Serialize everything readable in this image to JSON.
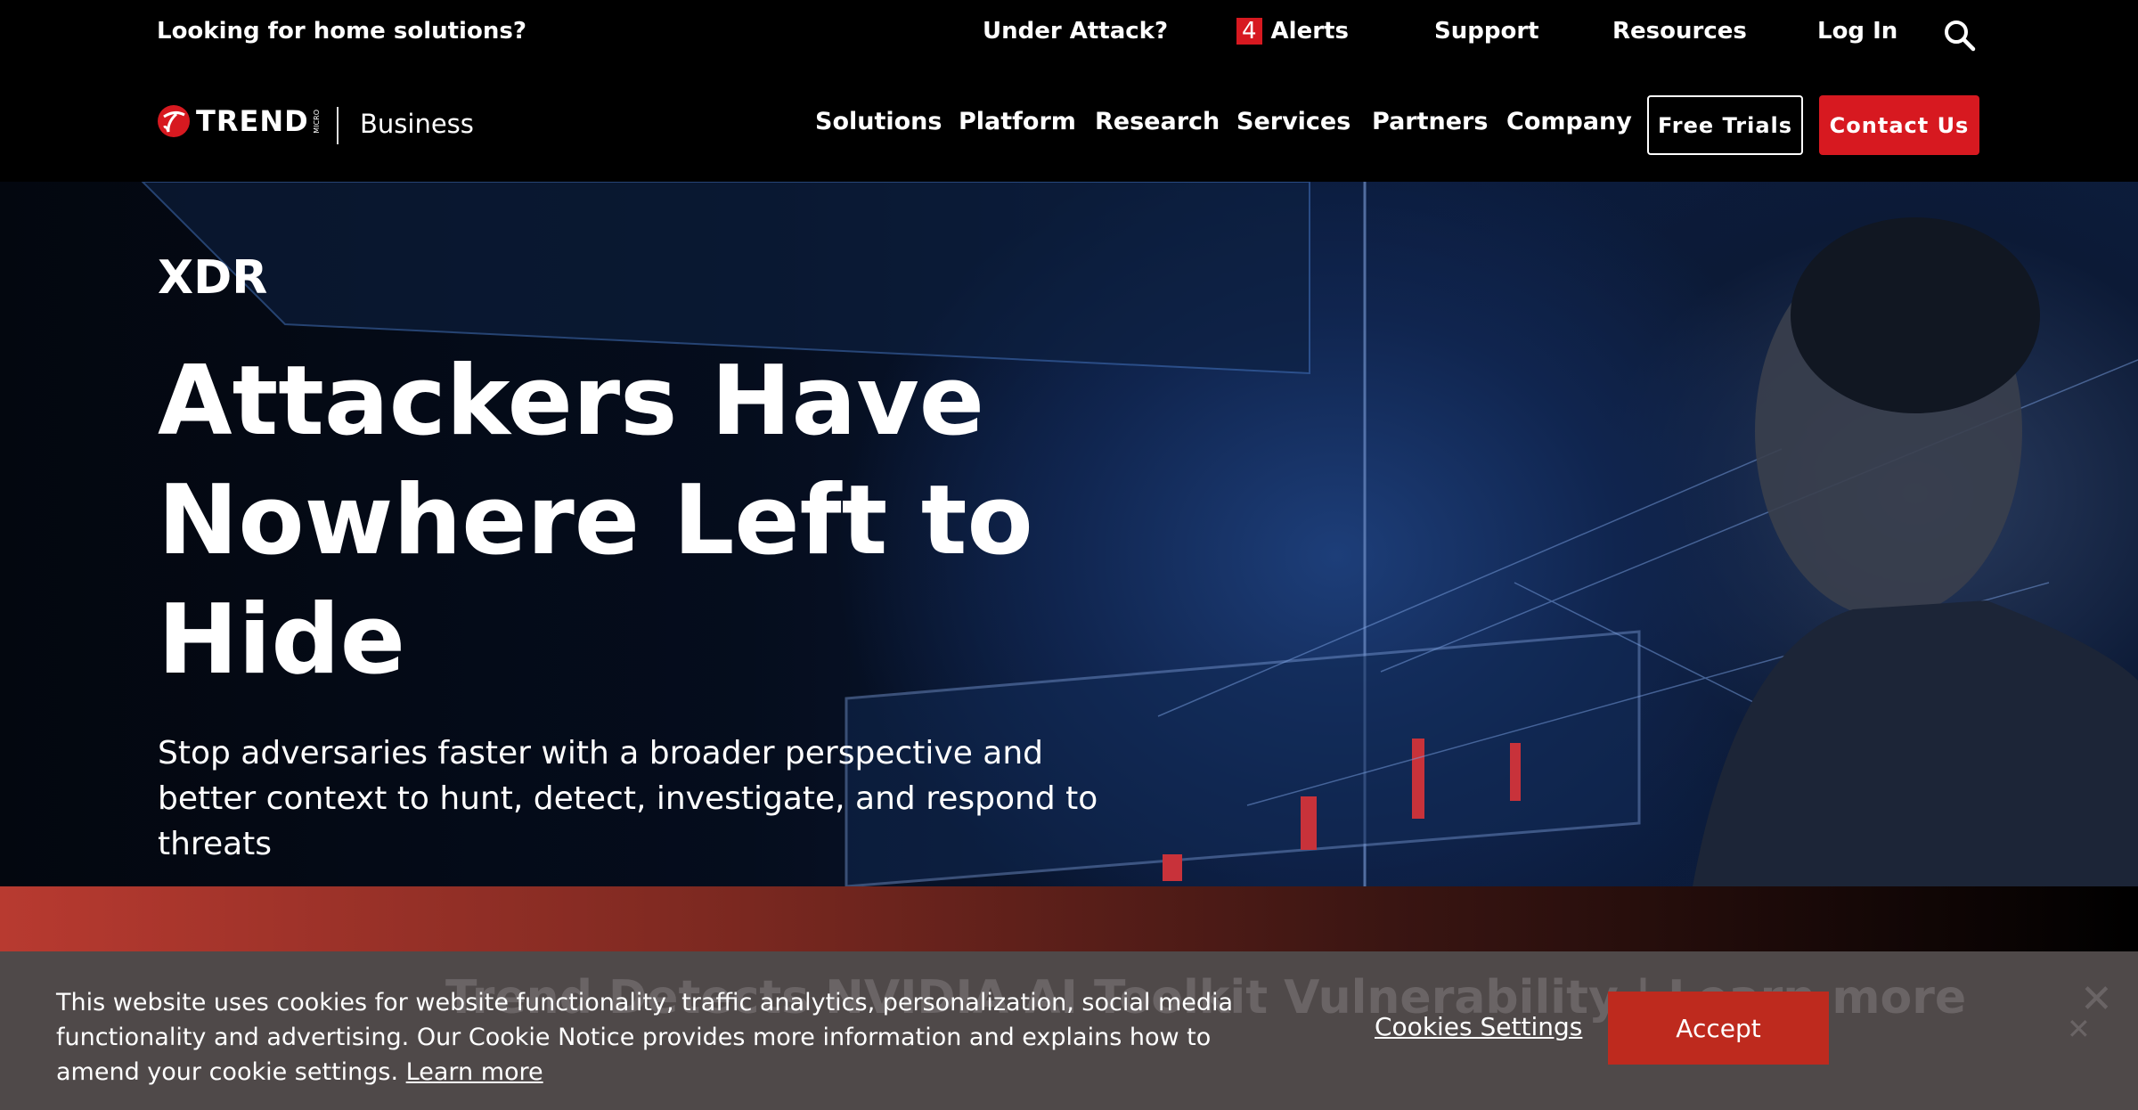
{
  "topbar": {
    "home_solutions": "Looking for home solutions?",
    "under_attack": "Under Attack?",
    "alerts_count": "4",
    "alerts": "Alerts",
    "support": "Support",
    "resources": "Resources",
    "login": "Log In",
    "search_icon": "search-icon"
  },
  "nav": {
    "logo": "TREND MICRO",
    "division": "Business",
    "items": [
      "Solutions",
      "Platform",
      "Research",
      "Services",
      "Partners",
      "Company"
    ],
    "free_trials": "Free Trials",
    "contact_us": "Contact Us"
  },
  "hero": {
    "eyebrow": "XDR",
    "headline": [
      "Attackers Have",
      "Nowhere Left to",
      "Hide"
    ],
    "subtitle": [
      "Stop adversaries faster with a broader perspective and",
      "better context to hunt, detect, investigate, and respond to",
      "threats"
    ]
  },
  "banner": {
    "text": "Trend Detects NVIDIA AI Toolkit Vulnerability | Learn more"
  },
  "cookie": {
    "text": "This website uses cookies for website functionality, traffic analytics, personalization, social media functionality and advertising. Our Cookie Notice provides more information and explains how to amend your cookie settings.",
    "learn_more": "Learn more",
    "settings": "Cookies Settings",
    "accept": "Accept"
  },
  "colors": {
    "brand_red": "#d71920",
    "accept": "#be2a1e",
    "cookie_bg": "#4f4949"
  }
}
